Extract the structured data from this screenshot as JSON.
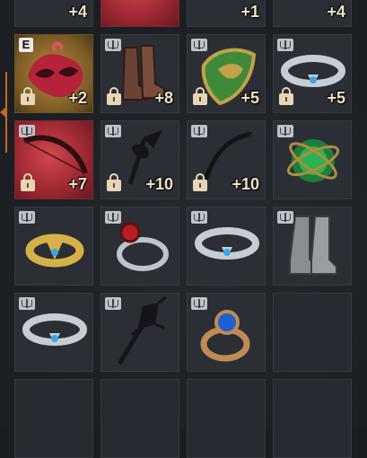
{
  "top_partial_row": [
    {
      "enhance": "+4",
      "slot_style": "dark"
    },
    {
      "enhance": "",
      "slot_style": "red"
    },
    {
      "enhance": "+1",
      "slot_style": "dark"
    },
    {
      "enhance": "+4",
      "slot_style": "dark"
    }
  ],
  "rows": [
    [
      {
        "name": "red-feather-mask",
        "badge": "E",
        "locked": true,
        "enhance": "+2",
        "bg": "gold",
        "icon": "mask-icon"
      },
      {
        "name": "leather-boots",
        "badge": "book",
        "locked": true,
        "enhance": "+8",
        "bg": "dark",
        "icon": "boots-icon"
      },
      {
        "name": "green-gold-shield",
        "badge": "book",
        "locked": true,
        "enhance": "+5",
        "bg": "dark",
        "icon": "shield-icon"
      },
      {
        "name": "silver-sapphire-ring",
        "badge": "book",
        "locked": true,
        "enhance": "+5",
        "bg": "dark",
        "icon": "ring-icon"
      }
    ],
    [
      {
        "name": "dark-bow",
        "badge": "book",
        "locked": true,
        "enhance": "+7",
        "bg": "red",
        "icon": "bow-icon"
      },
      {
        "name": "black-axe",
        "badge": "book",
        "locked": true,
        "enhance": "+10",
        "bg": "dark",
        "icon": "axe-icon"
      },
      {
        "name": "black-bow",
        "badge": "book",
        "locked": true,
        "enhance": "+10",
        "bg": "dark",
        "icon": "bow-icon"
      },
      {
        "name": "green-orb",
        "badge": "book",
        "locked": false,
        "enhance": "",
        "bg": "dark",
        "icon": "orb-icon"
      }
    ],
    [
      {
        "name": "gold-ring",
        "badge": "book",
        "locked": false,
        "enhance": "",
        "bg": "dark",
        "icon": "ring-icon"
      },
      {
        "name": "ruby-ring",
        "badge": "book",
        "locked": false,
        "enhance": "",
        "bg": "dark",
        "icon": "ring-icon"
      },
      {
        "name": "silver-ring",
        "badge": "book",
        "locked": false,
        "enhance": "",
        "bg": "dark",
        "icon": "ring-icon"
      },
      {
        "name": "iron-greaves",
        "badge": "book",
        "locked": false,
        "enhance": "",
        "bg": "dark",
        "icon": "boots-icon"
      }
    ],
    [
      {
        "name": "silver-ring-2",
        "badge": "book",
        "locked": false,
        "enhance": "",
        "bg": "dark",
        "icon": "ring-icon"
      },
      {
        "name": "spiked-mace",
        "badge": "book",
        "locked": false,
        "enhance": "",
        "bg": "dark",
        "icon": "mace-icon"
      },
      {
        "name": "sapphire-gold-ring",
        "badge": "book",
        "locked": false,
        "enhance": "",
        "bg": "dark",
        "icon": "ring-icon"
      },
      {
        "name": "empty",
        "badge": "",
        "locked": false,
        "enhance": "",
        "bg": "empty",
        "icon": ""
      }
    ],
    [
      {
        "name": "empty",
        "badge": "",
        "locked": false,
        "enhance": "",
        "bg": "empty",
        "icon": ""
      },
      {
        "name": "empty",
        "badge": "",
        "locked": false,
        "enhance": "",
        "bg": "empty",
        "icon": ""
      },
      {
        "name": "empty",
        "badge": "",
        "locked": false,
        "enhance": "",
        "bg": "empty",
        "icon": ""
      },
      {
        "name": "empty",
        "badge": "",
        "locked": false,
        "enhance": "",
        "bg": "empty",
        "icon": ""
      }
    ]
  ]
}
